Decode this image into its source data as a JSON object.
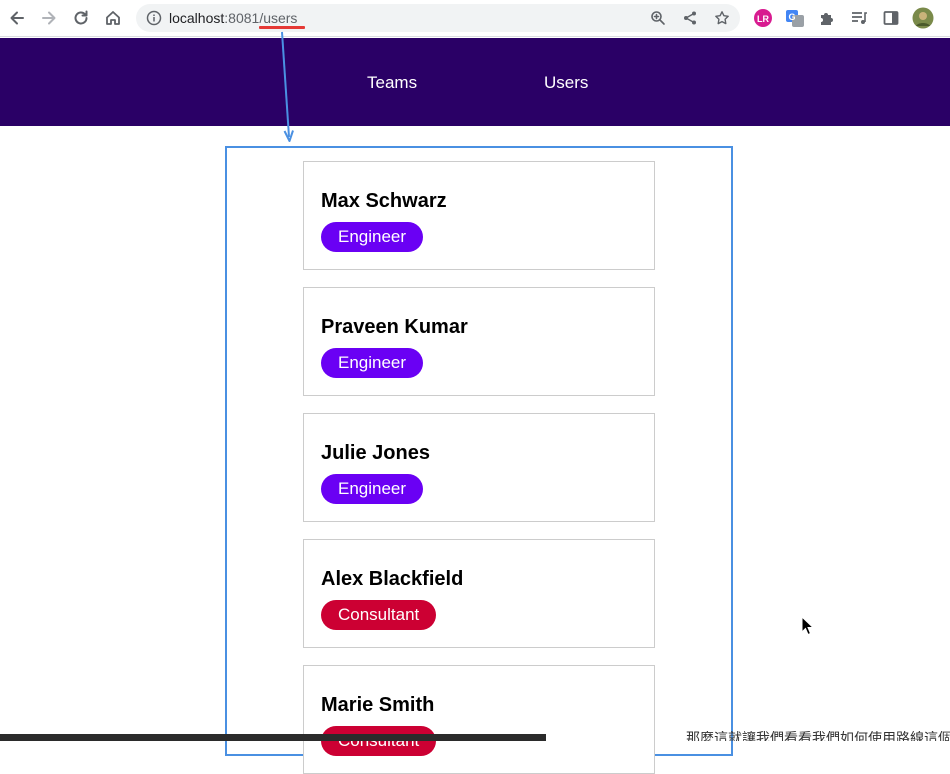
{
  "browser": {
    "url_host": "localhost",
    "url_port": ":8081",
    "url_path": "/users"
  },
  "header": {
    "nav_teams": "Teams",
    "nav_users": "Users",
    "background_color": "#2a0066"
  },
  "users": [
    {
      "name": "Max Schwarz",
      "role": "Engineer",
      "role_color": "#6a00f4"
    },
    {
      "name": "Praveen Kumar",
      "role": "Engineer",
      "role_color": "#6a00f4"
    },
    {
      "name": "Julie Jones",
      "role": "Engineer",
      "role_color": "#6a00f4"
    },
    {
      "name": "Alex Blackfield",
      "role": "Consultant",
      "role_color": "#cc0033"
    },
    {
      "name": "Marie Smith",
      "role": "Consultant",
      "role_color": "#cc0033"
    }
  ],
  "overlay": {
    "bottom_text": "那麼這就讓我們看看我們如何使用路線這個"
  },
  "colors": {
    "annotation_blue": "#4a90e2",
    "annotation_red": "#e53935"
  }
}
